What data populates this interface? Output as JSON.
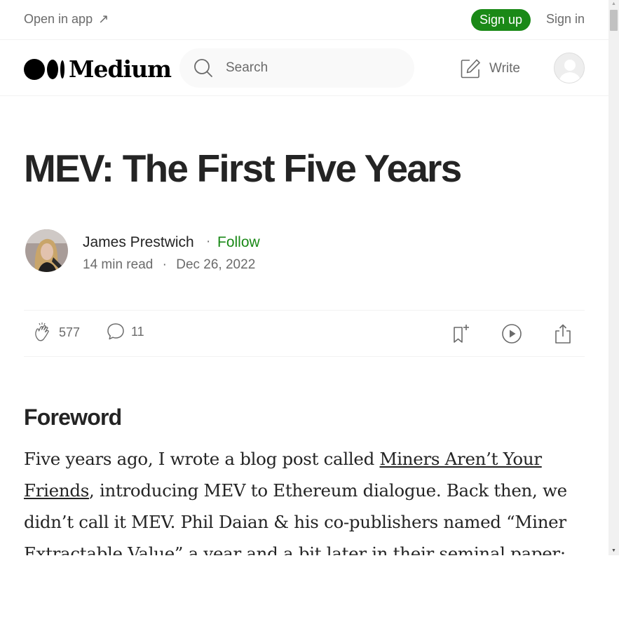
{
  "topbar": {
    "open_in_app": "Open in app",
    "open_in_app_arrow": "↗",
    "sign_up": "Sign up",
    "sign_in": "Sign in"
  },
  "header": {
    "logo_text": "Medium",
    "search_placeholder": "Search",
    "write_label": "Write"
  },
  "article": {
    "title": "MEV: The First Five Years",
    "author": {
      "name": "James Prestwich",
      "separator": "·",
      "follow_label": "Follow",
      "read_time": "14 min read",
      "meta_separator": "·",
      "date": "Dec 26, 2022"
    },
    "actions": {
      "claps": "577",
      "responses": "11"
    },
    "section_heading": "Foreword",
    "body": {
      "p1_start": "Five years ago, I wrote a blog post called ",
      "p1_link": "Miners Aren’t Your Friends",
      "p1_rest": ", introducing MEV to Ethereum dialogue. Back then, we didn’t call it MEV. Phil Daian & his co-publishers named “Miner Extractable Value” a year and a bit later in their seminal paper:"
    }
  },
  "colors": {
    "brand_green": "#1a8917",
    "text_primary": "#242424",
    "text_secondary": "#6b6b6b"
  },
  "icons": [
    "arrow-up-right-icon",
    "search-icon",
    "write-icon",
    "avatar-icon",
    "clap-icon",
    "comment-icon",
    "bookmark-add-icon",
    "play-icon",
    "share-icon"
  ]
}
